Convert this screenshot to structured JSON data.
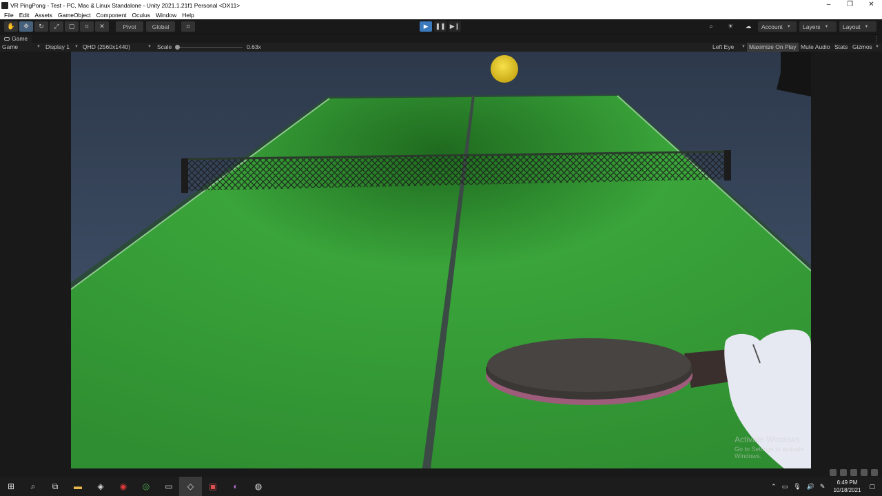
{
  "window": {
    "title": "VR PingPong - Test - PC, Mac & Linux Standalone - Unity 2021.1.21f1 Personal <DX11>",
    "controls": {
      "minimize": "–",
      "maximize": "❐",
      "close": "✕"
    }
  },
  "menu": [
    "File",
    "Edit",
    "Assets",
    "GameObject",
    "Component",
    "Oculus",
    "Window",
    "Help"
  ],
  "toolbar": {
    "pivot_label": "Pivot",
    "global_label": "Global",
    "account_label": "Account",
    "layers_label": "Layers",
    "layout_label": "Layout",
    "play_state": "playing"
  },
  "game_tab": {
    "label": "Game"
  },
  "game_bar": {
    "view_label": "Game",
    "display_label": "Display 1",
    "resolution_label": "QHD (2560x1440)",
    "scale_label": "Scale",
    "scale_value": "0.63x",
    "eye_label": "Left Eye",
    "maximize_label": "Maximize On Play",
    "mute_label": "Mute Audio",
    "stats_label": "Stats",
    "gizmos_label": "Gizmos",
    "scale_fraction": 0.0
  },
  "watermark": {
    "line1": "Activate Windows",
    "line2": "Go to Settings to activate Windows."
  },
  "taskbar": {
    "time": "6:49 PM",
    "date": "10/18/2021"
  },
  "colors": {
    "table": "#3a9d3a",
    "ball": "#e8cf2a",
    "play_button": "#3a79bb"
  }
}
